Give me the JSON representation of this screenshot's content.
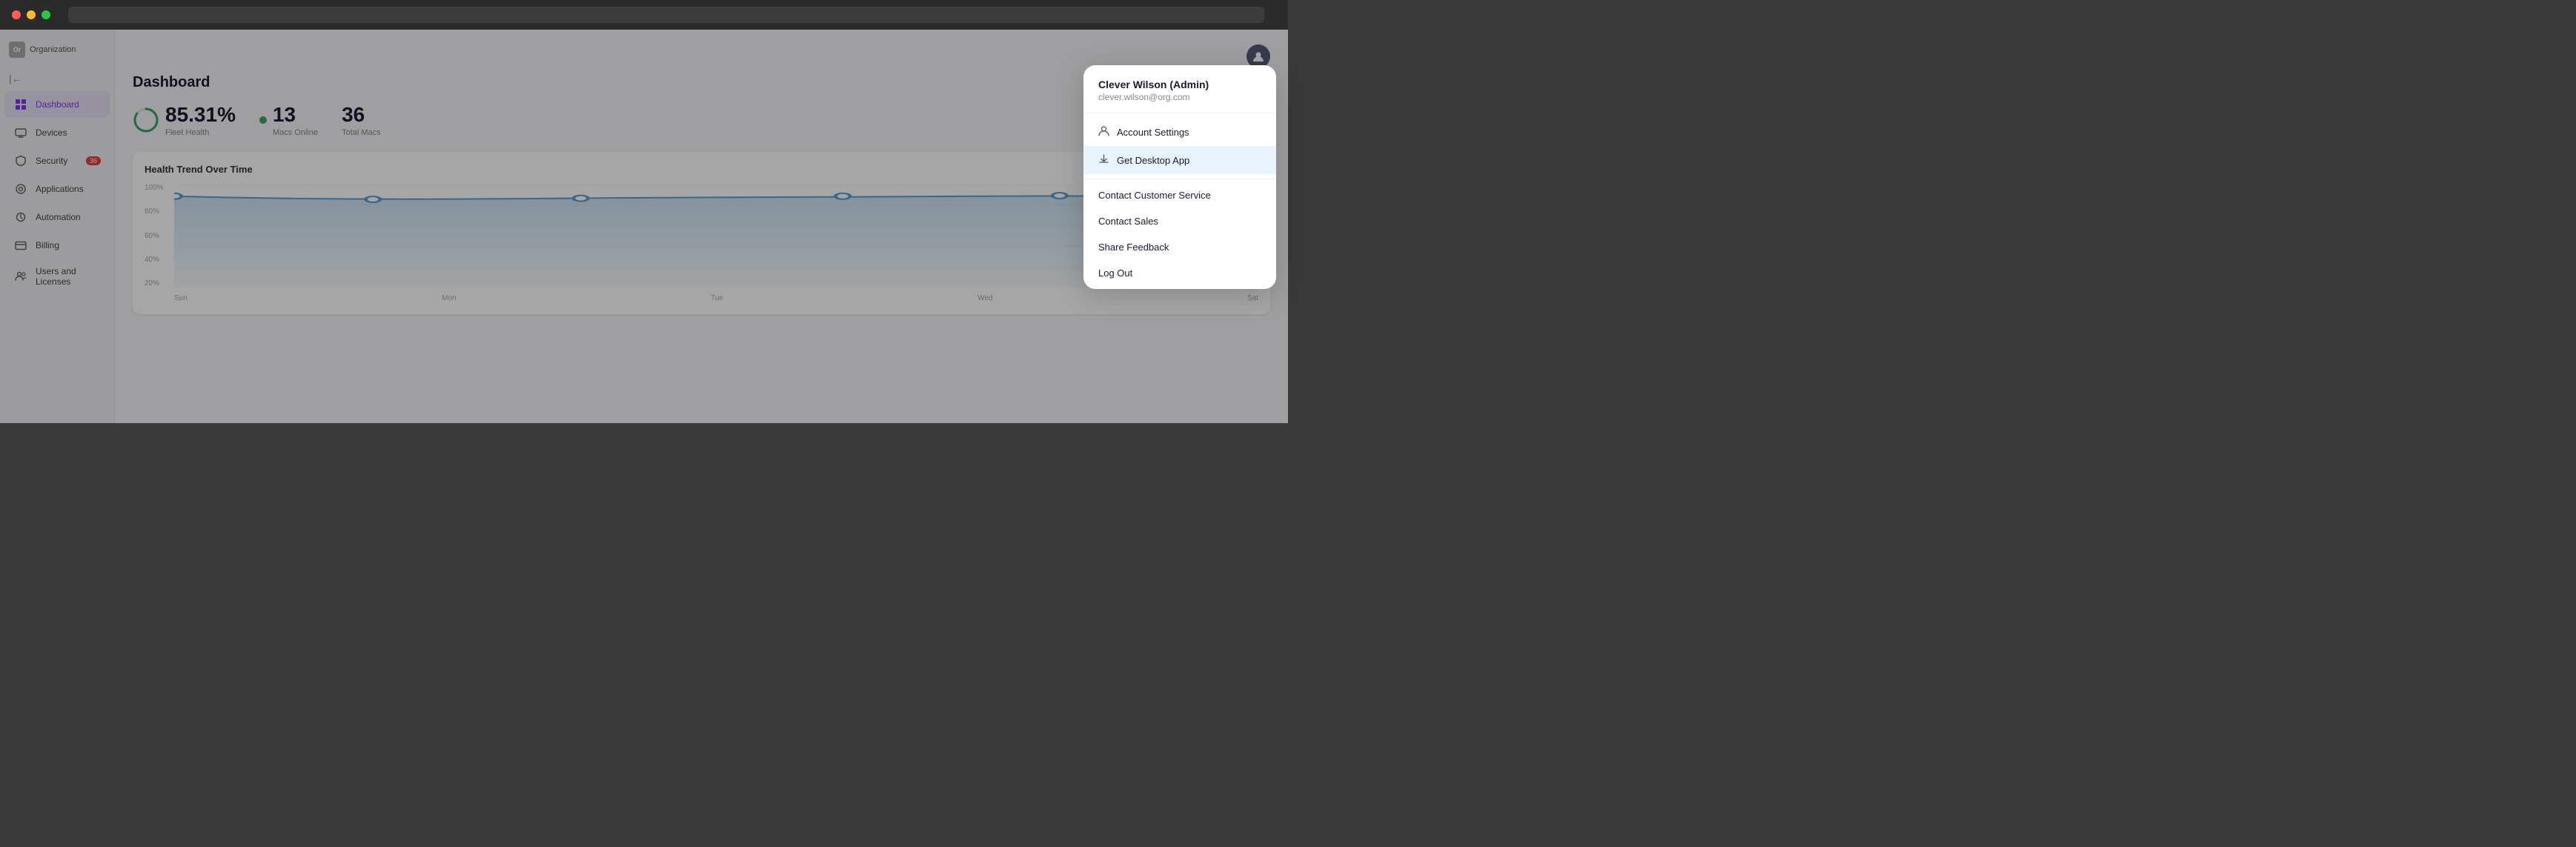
{
  "browser": {
    "url_placeholder": ""
  },
  "sidebar": {
    "org_label": "Organization",
    "collapse_icon": "◀",
    "items": [
      {
        "id": "dashboard",
        "label": "Dashboard",
        "icon": "grid",
        "active": true,
        "badge": null
      },
      {
        "id": "devices",
        "label": "Devices",
        "icon": "monitor",
        "active": false,
        "badge": null
      },
      {
        "id": "security",
        "label": "Security",
        "icon": "shield",
        "active": false,
        "badge": "36"
      },
      {
        "id": "applications",
        "label": "Applications",
        "icon": "layers",
        "active": false,
        "badge": null
      },
      {
        "id": "automation",
        "label": "Automation",
        "icon": "zap",
        "active": false,
        "badge": null
      },
      {
        "id": "billing",
        "label": "Billing",
        "icon": "credit-card",
        "active": false,
        "badge": null
      },
      {
        "id": "users",
        "label": "Users and Licenses",
        "icon": "users",
        "active": false,
        "badge": null
      }
    ]
  },
  "main": {
    "page_title": "Dashboard",
    "stats": {
      "health_percent": "85.31%",
      "health_label": "Fleet Health",
      "macs_online": "13",
      "macs_online_label": "Macs Online",
      "total_macs": "36",
      "total_macs_label": "Total Macs"
    },
    "chart": {
      "title": "Health Trend Over Time",
      "y_labels": [
        "100%",
        "80%",
        "60%",
        "40%",
        "20%"
      ],
      "x_labels": [
        "Sun",
        "Mon",
        "Tue",
        "Wed",
        "Sat"
      ],
      "line_data": [
        {
          "x": 0,
          "y": 0.88
        },
        {
          "x": 0.18,
          "y": 0.85
        },
        {
          "x": 0.38,
          "y": 0.85
        },
        {
          "x": 0.58,
          "y": 0.87
        },
        {
          "x": 0.77,
          "y": 0.86
        },
        {
          "x": 1.0,
          "y": 0.86
        }
      ]
    }
  },
  "dropdown": {
    "user_name": "Clever Wilson (Admin)",
    "user_email": "clever.wilson@org.com",
    "items_top": [
      {
        "id": "account-settings",
        "label": "Account Settings",
        "icon": "person"
      },
      {
        "id": "get-desktop-app",
        "label": "Get Desktop App",
        "icon": "download",
        "highlighted": true
      }
    ],
    "items_bottom": [
      {
        "id": "contact-customer-service",
        "label": "Contact Customer Service"
      },
      {
        "id": "contact-sales",
        "label": "Contact Sales"
      },
      {
        "id": "share-feedback",
        "label": "Share Feedback"
      },
      {
        "id": "log-out",
        "label": "Log Out"
      }
    ]
  }
}
